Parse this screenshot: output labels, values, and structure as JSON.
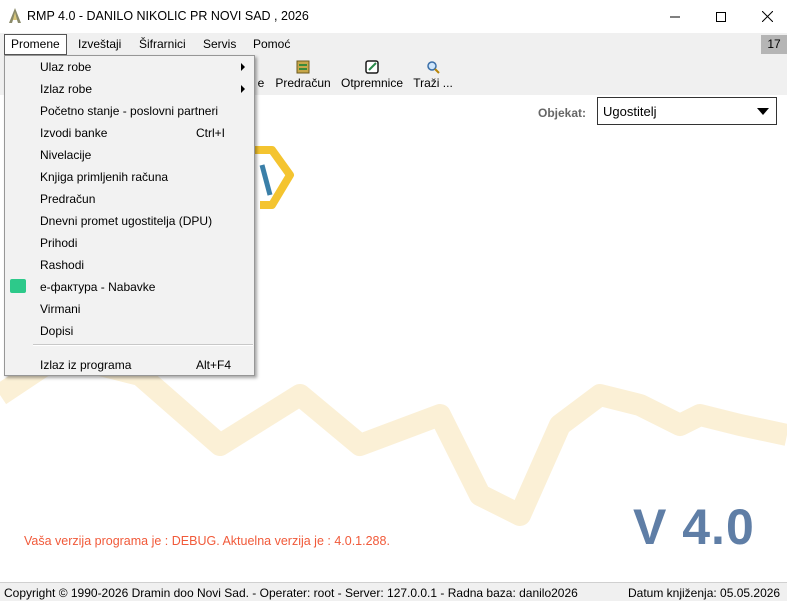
{
  "window": {
    "title": "RMP 4.0 - DANILO NIKOLIC PR NOVI SAD , 2026",
    "icon": "rmp-app-icon"
  },
  "menubar": {
    "items": [
      "Promene",
      "Izveštaji",
      "Šifrarnici",
      "Servis",
      "Pomoć"
    ],
    "badge": "17"
  },
  "toolbar": {
    "buttons": [
      {
        "label": "e",
        "icon": "unknown-icon"
      },
      {
        "label": "Predračun",
        "icon": "document-icon"
      },
      {
        "label": "Otpremnice",
        "icon": "edit-icon"
      },
      {
        "label": "Traži ...",
        "icon": "search-icon"
      }
    ]
  },
  "dropdown": {
    "items": [
      {
        "label": "Ulaz robe",
        "submenu": true
      },
      {
        "label": "Izlaz robe",
        "submenu": true
      },
      {
        "label": "Početno stanje - poslovni partneri"
      },
      {
        "label": "Izvodi banke",
        "shortcut": "Ctrl+I"
      },
      {
        "label": "Nivelacije"
      },
      {
        "label": "Knjiga primljenih računa"
      },
      {
        "label": "Predračun"
      },
      {
        "label": "Dnevni promet ugostitelja  (DPU)"
      },
      {
        "label": "Prihodi"
      },
      {
        "label": "Rashodi"
      },
      {
        "label": "e-фактура - Nabavke",
        "icon": "e-faktura-icon"
      },
      {
        "label": "Virmani"
      },
      {
        "label": "Dopisi"
      },
      {
        "label": "Izlaz iz programa",
        "shortcut": "Alt+F4"
      }
    ]
  },
  "objekat": {
    "label": "Objekat:",
    "value": "Ugostitelj"
  },
  "version": {
    "message": "Vaša verzija programa je : DEBUG. Aktuelna verzija je : 4.0.1.288.",
    "big": "V 4.0"
  },
  "status": {
    "left": "Copyright © 1990-2026 Dramin doo Novi Sad. - Operater: root - Server: 127.0.0.1 - Radna baza: danilo2026",
    "right": "Datum knjiženja: 05.05.2026"
  },
  "colors": {
    "version_message": "#f15a3a",
    "version_big": "#5f7ea6",
    "watermark": "#fbf0d6",
    "efaktura_icon": "#2dc98a"
  }
}
